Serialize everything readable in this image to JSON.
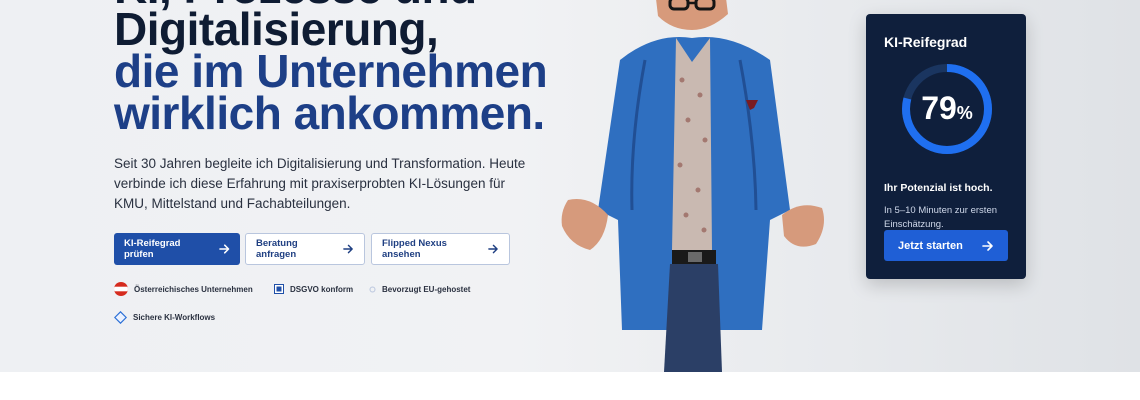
{
  "hero": {
    "headline_line1": "KI, Prozesse und",
    "headline_line2": "Digitalisierung,",
    "headline_line3": "die im Unternehmen",
    "headline_line4": "wirklich ankommen.",
    "lead": "Seit 30 Jahren begleite ich Digitalisierung und Transformation. Heute verbinde ich diese Erfahrung mit praxiserprobten KI-Lösungen für KMU, Mittelstand und Fachabteilungen."
  },
  "buttons": {
    "primary_label": "KI-Reifegrad prüfen",
    "consult_label": "Beratung anfragen",
    "flipped_label": "Flipped Nexus ansehen"
  },
  "badges": {
    "austria": "Österreichisches Unternehmen",
    "dsgvo": "DSGVO konform",
    "eu": "Bevorzugt EU-gehostet",
    "secure": "Sichere KI-Workflows"
  },
  "card": {
    "title": "KI-Reifegrad",
    "score": "79",
    "score_unit": "%",
    "score_value": 0.79,
    "subtitle": "Ihr Potenzial ist hoch.",
    "description": "In 5–10 Minuten zur ersten Einschätzung.",
    "cta_label": "Jetzt starten"
  },
  "colors": {
    "headline_dark": "#0f1c33",
    "headline_blue": "#1d3f87",
    "primary": "#1f4fa8",
    "card_bg": "#0f1f3c",
    "card_cta": "#1f5fd6",
    "gauge_ring": "#1f6ff0"
  }
}
